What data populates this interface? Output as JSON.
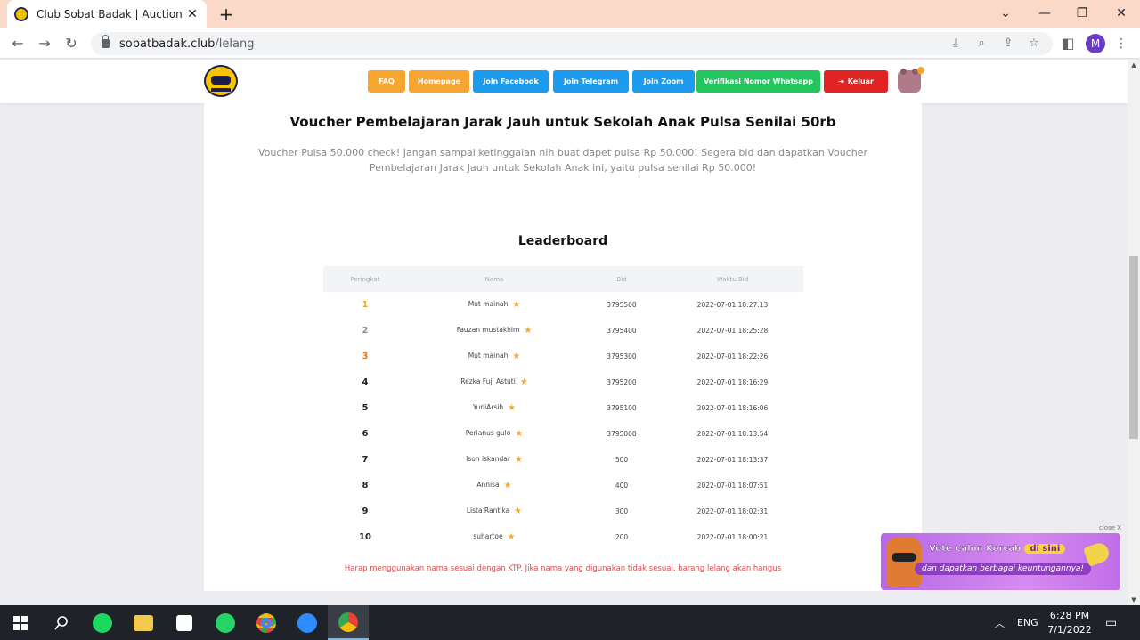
{
  "browser": {
    "tab_title": "Club Sobat Badak | Auction",
    "url_host": "sobatbadak.club",
    "url_path": "/lelang",
    "profile_initial": "M"
  },
  "site_nav": [
    {
      "label": "FAQ",
      "color": "#f7a531"
    },
    {
      "label": "Homepage",
      "color": "#f7a531"
    },
    {
      "label": "Join Facebook",
      "color": "#1c9bef"
    },
    {
      "label": "Join Telegram",
      "color": "#1c9bef"
    },
    {
      "label": "Join Zoom",
      "color": "#1c9bef"
    },
    {
      "label": "Verifikasi Nomor Whatsapp",
      "color": "#22c55e"
    },
    {
      "label": "Keluar",
      "color": "#e02424"
    }
  ],
  "product": {
    "title": "Voucher Pembelajaran Jarak Jauh untuk Sekolah Anak Pulsa Senilai 50rb",
    "description": "Voucher Pulsa 50.000 check! Jangan sampai ketinggalan nih buat dapet pulsa Rp 50.000! Segera bid dan dapatkan Voucher Pembelajaran Jarak Jauh untuk Sekolah Anak ini, yaitu pulsa senilai Rp 50.000!"
  },
  "leaderboard": {
    "title": "Leaderboard",
    "headers": [
      "Peringkat",
      "Nama",
      "Bid",
      "Waktu Bid"
    ],
    "rows": [
      {
        "rank": "1",
        "name": "Mut mainah",
        "bid": "3795500",
        "time": "2022-07-01 18:27:13",
        "rank_color": "#f7a531"
      },
      {
        "rank": "2",
        "name": "Fauzan mustakhim",
        "bid": "3795400",
        "time": "2022-07-01 18:25:28",
        "rank_color": "#8a8a8a"
      },
      {
        "rank": "3",
        "name": "Mut mainah",
        "bid": "3795300",
        "time": "2022-07-01 18:22:26",
        "rank_color": "#e8781f"
      },
      {
        "rank": "4",
        "name": "Rezka Fuji Astuti",
        "bid": "3795200",
        "time": "2022-07-01 18:16:29",
        "rank_color": "#222"
      },
      {
        "rank": "5",
        "name": "YuniArsih",
        "bid": "3795100",
        "time": "2022-07-01 18:16:06",
        "rank_color": "#222"
      },
      {
        "rank": "6",
        "name": "Perianus gulo",
        "bid": "3795000",
        "time": "2022-07-01 18:13:54",
        "rank_color": "#222"
      },
      {
        "rank": "7",
        "name": "Ison iskandar",
        "bid": "500",
        "time": "2022-07-01 18:13:37",
        "rank_color": "#222"
      },
      {
        "rank": "8",
        "name": "Annisa",
        "bid": "400",
        "time": "2022-07-01 18:07:51",
        "rank_color": "#222"
      },
      {
        "rank": "9",
        "name": "Lista Rantika",
        "bid": "300",
        "time": "2022-07-01 18:02:31",
        "rank_color": "#222"
      },
      {
        "rank": "10",
        "name": "suhartoe",
        "bid": "200",
        "time": "2022-07-01 18:00:21",
        "rank_color": "#222"
      }
    ],
    "warning": "Harap menggunakan nama sesuai dengan KTP. Jika nama yang digunakan tidak sesuai, barang lelang akan hangus"
  },
  "ad": {
    "close_label": "close X",
    "line1": "Vote Calon Korcab",
    "line1_pill": "di sini",
    "line2": "dan dapatkan berbagai keuntungannya!"
  },
  "taskbar": {
    "lang": "ENG",
    "time": "6:28 PM",
    "date": "7/1/2022"
  }
}
